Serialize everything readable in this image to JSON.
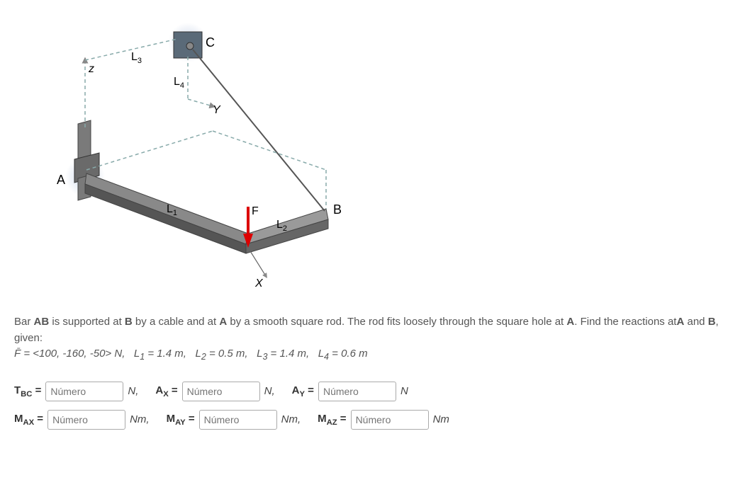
{
  "diagram": {
    "labels": {
      "A": "A",
      "B": "B",
      "C": "C",
      "L1": "L",
      "L1sub": "1",
      "L2": "L",
      "L2sub": "2",
      "L3": "L",
      "L3sub": "3",
      "L4": "L",
      "L4sub": "4",
      "F": "F",
      "X": "X",
      "Y": "Y",
      "Z": "z"
    }
  },
  "problem": {
    "line1_a": "Bar ",
    "line1_ab": "AB",
    "line1_b": " is supported at ",
    "line1_B": "B",
    "line1_c": " by a cable and at ",
    "line1_A": "A",
    "line1_d": " by a smooth square rod. The rod fits loosely through the square hole at ",
    "line1_A2": "A",
    "line1_e": ". Find the reactions at",
    "line1_A3": "A",
    "line1_f": " and ",
    "line1_B2": "B",
    "line1_g": ", given:",
    "force_label": "F̄",
    "force_eq": " = <100, -160, -50> ",
    "force_unit": "N,",
    "L1_lbl": "L",
    "L1_sub": "1",
    "L1_val": " = 1.4 ",
    "L1_unit": "m,",
    "L2_lbl": "L",
    "L2_sub": "2",
    "L2_val": " = 0.5 ",
    "L2_unit": "m,",
    "L3_lbl": "L",
    "L3_sub": "3",
    "L3_val": " = 1.4 ",
    "L3_unit": "m,",
    "L4_lbl": "L",
    "L4_sub": "4",
    "L4_val": " = 0.6 ",
    "L4_unit": "m"
  },
  "answers": {
    "placeholder": "Número",
    "tbc": {
      "lbl": "T",
      "sub": "BC",
      "eq": " = ",
      "unit": "N,"
    },
    "ax": {
      "lbl": "A",
      "sub": "X",
      "eq": " = ",
      "unit": "N,"
    },
    "ay": {
      "lbl": "A",
      "sub": "Y",
      "eq": " = ",
      "unit": "N"
    },
    "max": {
      "lbl": "M",
      "sub": "AX",
      "eq": " = ",
      "unit": "Nm,"
    },
    "may": {
      "lbl": "M",
      "sub": "AY",
      "eq": " = ",
      "unit": "Nm,"
    },
    "maz": {
      "lbl": "M",
      "sub": "AZ",
      "eq": " = ",
      "unit": "Nm"
    }
  }
}
